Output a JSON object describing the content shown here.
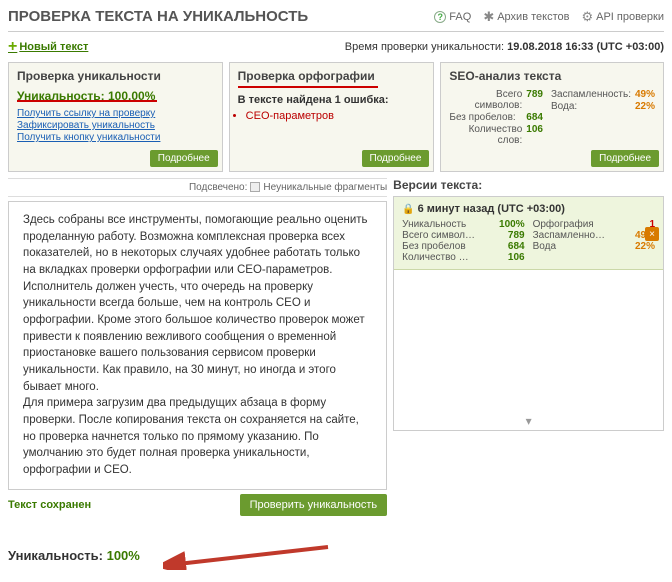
{
  "header": {
    "title": "ПРОВЕРКА ТЕКСТА НА УНИКАЛЬНОСТЬ",
    "faq": "FAQ",
    "archive": "Архив текстов",
    "api": "API проверки"
  },
  "new_text": "Новый текст",
  "timestamp_label": "Время проверки уникальности:",
  "timestamp_value": "19.08.2018 16:33 (UTC +03:00)",
  "card_uniq": {
    "title": "Проверка уникальности",
    "label": "Уникальность:",
    "value": "100.00%",
    "link1": "Получить ссылку на проверку",
    "link2": "Зафиксировать уникальность",
    "link3": "Получить кнопку уникальности",
    "more": "Подробнее"
  },
  "card_spell": {
    "title": "Проверка орфографии",
    "found": "В тексте найдена 1 ошибка:",
    "item1": "СЕО-параметров",
    "more": "Подробнее"
  },
  "card_seo": {
    "title": "SEO-анализ текста",
    "all_chars_lbl": "Всего символов:",
    "all_chars": "789",
    "no_sp_lbl": "Без пробелов:",
    "no_sp": "684",
    "words_lbl": "Количество слов:",
    "words": "106",
    "spam_lbl": "Заспамленность:",
    "spam": "49%",
    "water_lbl": "Вода:",
    "water": "22%",
    "more": "Подробнее"
  },
  "legend": {
    "label": "Подсвечено:",
    "item": "Неуникальные фрагменты"
  },
  "body_text": "Здесь собраны все инструменты, помогающие реально оценить проделанную работу. Возможна комплексная проверка всех показателей, но в некоторых случаях удобнее работать только на вкладках проверки орфографии или СЕО-параметров.\nИсполнитель должен учесть, что очередь на проверку уникальности всегда больше, чем на контроль СЕО и орфографии. Кроме этого большое количество проверок может привести к появлению вежливого сообщения о временной приостановке вашего пользования сервисом проверки уникальности. Как правило, на 30 минут, но иногда и этого бывает много.\nДля примера загрузим два предыдущих абзаца в форму проверки. После копирования текста он сохраняется на сайте, но проверка начнется только по прямому указанию. По умолчанию это будет полная проверка уникальности, орфографии и СЕО.",
  "saved": "Текст сохранен",
  "check_btn": "Проверить уникальность",
  "versions": {
    "title": "Версии текста:",
    "time": "6 минут назад  (UTC +03:00)",
    "uniq_lbl": "Уникальность",
    "uniq": "100%",
    "all_lbl": "Всего символ…",
    "all": "789",
    "nosp_lbl": "Без пробелов",
    "nosp": "684",
    "words_lbl": "Количество …",
    "words": "106",
    "orth_lbl": "Орфография",
    "orth": "1",
    "spam_lbl": "Заспамленно…",
    "spam": "49%",
    "water_lbl": "Вода",
    "water": "22%"
  },
  "bottom": {
    "label": "Уникальность:",
    "value": "100%"
  }
}
